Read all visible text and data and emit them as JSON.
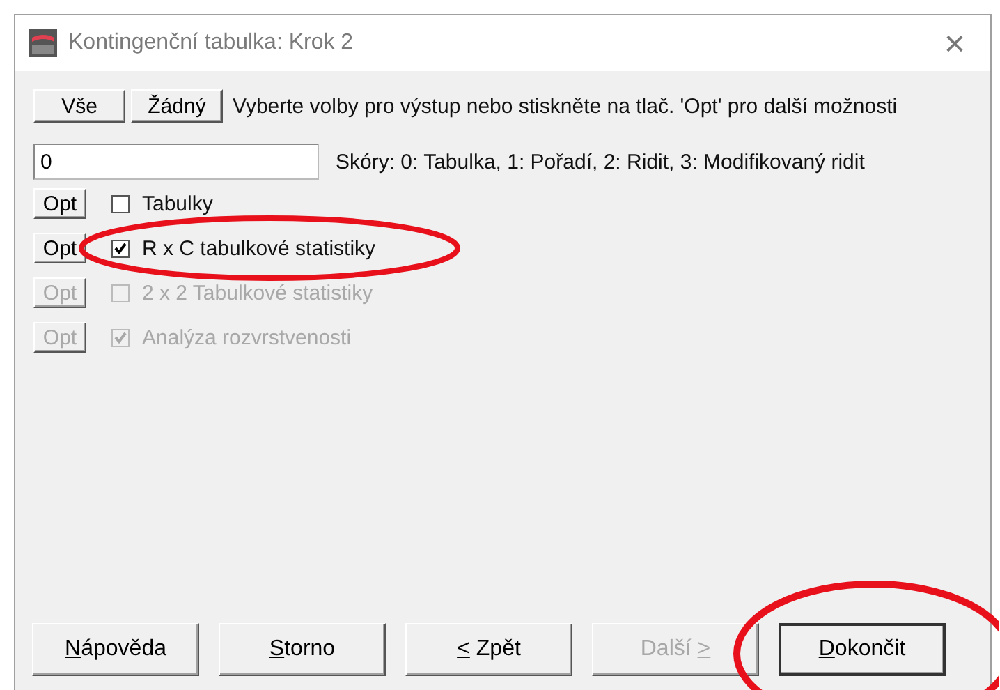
{
  "window": {
    "title": "Kontingenční tabulka: Krok 2",
    "close": "×"
  },
  "select_buttons": [
    {
      "label": "Vše"
    },
    {
      "label": "Žádný"
    }
  ],
  "instruction": "Vyberte volby pro výstup nebo stiskněte na tlač. 'Opt' pro další možnosti",
  "score_field": {
    "value": "0"
  },
  "score_hint": "Skóry: 0: Tabulka, 1: Pořadí, 2: Ridit, 3: Modifikovaný ridit",
  "options": [
    {
      "button": "Opt",
      "label": "Tabulky",
      "checked": false,
      "disabled": false,
      "highlighted": false
    },
    {
      "button": "Opt",
      "label": "R x C tabulkové statistiky",
      "checked": true,
      "disabled": false,
      "highlighted": true
    },
    {
      "button": "Opt",
      "label": "2 x 2 Tabulkové statistiky",
      "checked": false,
      "disabled": true,
      "highlighted": false
    },
    {
      "button": "Opt",
      "label": "Analýza rozvrstvenosti",
      "checked": true,
      "disabled": true,
      "highlighted": false
    }
  ],
  "buttons": [
    {
      "label": "Nápověda",
      "mnemonic_last": false,
      "disabled": false,
      "default": false,
      "highlighted": false
    },
    {
      "label": "Storno",
      "mnemonic_last": false,
      "disabled": false,
      "default": false,
      "highlighted": false
    },
    {
      "label": "< Zpět",
      "mnemonic_last": false,
      "disabled": false,
      "default": false,
      "highlighted": false
    },
    {
      "label": "Další >",
      "mnemonic_last": true,
      "disabled": true,
      "default": false,
      "highlighted": false
    },
    {
      "label": "Dokončit",
      "mnemonic_last": false,
      "disabled": false,
      "default": true,
      "highlighted": true
    }
  ]
}
